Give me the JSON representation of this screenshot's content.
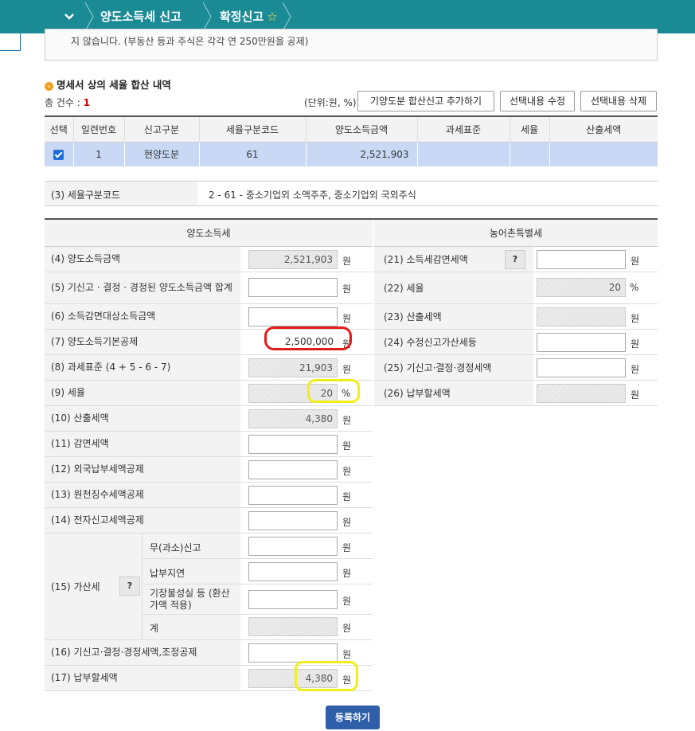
{
  "topbar": {
    "crumb1": "양도소득세 신고",
    "crumb2": "확정신고"
  },
  "notice": "지 않습니다. (부동산 등과 주식은 각각 연 250만원을 공제)",
  "section": {
    "title": "명세서 상의 세율 합산 내역",
    "count_label": "총 건수 : ",
    "count_value": "1",
    "unit_note": "(단위:원, %)"
  },
  "buttons": {
    "add": "기양도분 합산신고 추가하기",
    "edit": "선택내용 수정",
    "delete": "선택내용 삭제",
    "submit": "등록하기"
  },
  "summary": {
    "headers": [
      "선택",
      "일련번호",
      "신고구분",
      "세율구분코드",
      "양도소득금액",
      "과세표준",
      "세율",
      "산출세액"
    ],
    "row": {
      "serial": "1",
      "type": "현양도분",
      "code": "61",
      "amount": "2,521,903",
      "base": "",
      "rate": "",
      "tax": ""
    }
  },
  "code_row": {
    "label": "(3) 세율구분코드",
    "value": "2  -  61  -  중소기업외 소액주주, 중소기업외 국외주식"
  },
  "left": {
    "header": "양도소득세",
    "r4": {
      "label": "(4) 양도소득금액",
      "value": "2,521,903",
      "unit": "원"
    },
    "r5": {
      "label": "(5) 기신고 · 결정 · 경정된 양도소득금액 합계",
      "value": "",
      "unit": "원"
    },
    "r6": {
      "label": "(6) 소득감면대상소득금액",
      "value": "",
      "unit": "원"
    },
    "r7": {
      "label": "(7) 양도소득기본공제",
      "value": "2,500,000",
      "unit": "원"
    },
    "r8": {
      "label": "(8) 과세표준 (4 + 5 - 6 - 7)",
      "value": "21,903",
      "unit": "원"
    },
    "r9": {
      "label": "(9) 세율",
      "value": "20",
      "unit": "%"
    },
    "r10": {
      "label": "(10) 산출세액",
      "value": "4,380",
      "unit": "원"
    },
    "r11": {
      "label": "(11) 감면세액",
      "value": "",
      "unit": "원"
    },
    "r12": {
      "label": "(12) 외국납부세액공제",
      "value": "",
      "unit": "원"
    },
    "r13": {
      "label": "(13) 원천징수세액공제",
      "value": "",
      "unit": "원"
    },
    "r14": {
      "label": "(14) 전자신고세액공제",
      "value": "",
      "unit": "원"
    },
    "r15": {
      "label": "(15) 가산세",
      "q": "?",
      "subs": [
        {
          "label": "무(과소)신고",
          "value": "",
          "unit": "원"
        },
        {
          "label": "납부지연",
          "value": "",
          "unit": "원"
        },
        {
          "label": "기장불성실 등 (환산가액 적용)",
          "value": "",
          "unit": "원"
        },
        {
          "label": "계",
          "value": "",
          "unit": "원"
        }
      ]
    },
    "r16": {
      "label": "(16) 기신고·결정·경정세액,조정공제",
      "value": "",
      "unit": "원"
    },
    "r17": {
      "label": "(17) 납부할세액",
      "value": "4,380",
      "unit": "원"
    }
  },
  "right": {
    "header": "농어촌특별세",
    "r21": {
      "label": "(21) 소득세감면세액",
      "q": "?",
      "value": "",
      "unit": "원"
    },
    "r22": {
      "label": "(22) 세율",
      "value": "20",
      "unit": "%"
    },
    "r23": {
      "label": "(23) 산출세액",
      "value": "",
      "unit": "원"
    },
    "r24": {
      "label": "(24) 수정신고가산세등",
      "value": "",
      "unit": "원"
    },
    "r25": {
      "label": "(25) 기신고·결정·경정세액",
      "value": "",
      "unit": "원"
    },
    "r26": {
      "label": "(26) 납부할세액",
      "value": "",
      "unit": "원"
    }
  }
}
